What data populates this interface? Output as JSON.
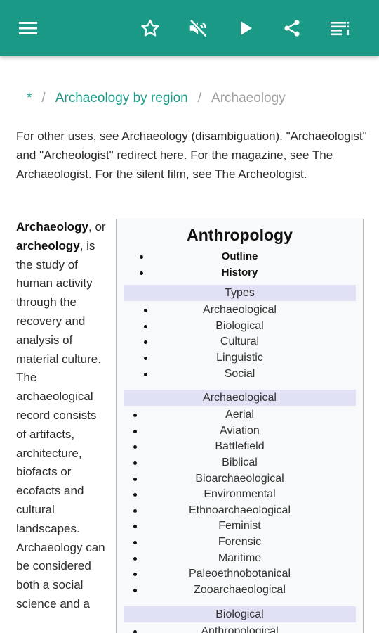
{
  "toolbar": {
    "menu_icon": "menu-icon",
    "favorite_icon": "star-outline-icon",
    "mute_icon": "volume-off-icon",
    "play_icon": "play-icon",
    "share_icon": "share-icon",
    "toc_icon": "list-icon",
    "accent_color": "#1a9a86"
  },
  "breadcrumb": {
    "home": "*",
    "separator": "/",
    "parent": "Archaeology by region",
    "current": "Archaeology"
  },
  "hatnote": "For other uses, see Archaeology (disambiguation). \"Archaeologist\" and \"Archeologist\" redirect here. For the magazine, see The Archaeologist. For the silent film, see The Archeologist.",
  "lead": {
    "term1": "Archaeology",
    "sep1": ",",
    "or": "or",
    "term2": "archeology",
    "rest": ", is the study of human activity through the recovery and analysis of material culture. The archaeological record consists of artifacts, architecture, biofacts or ecofacts and cultural landscapes. Archaeology can be considered both a social science and a"
  },
  "infobox": {
    "title": "Anthropology",
    "top_items": [
      "Outline",
      "History"
    ],
    "types_heading": "Types",
    "types": [
      "Archaeological",
      "Biological",
      "Cultural",
      "Linguistic",
      "Social"
    ],
    "archaeological_heading": "Archaeological",
    "archaeological": [
      "Aerial",
      "Aviation",
      "Battlefield",
      "Biblical",
      "Bioarchaeological",
      "Environmental",
      "Ethnoarchaeological",
      "Feminist",
      "Forensic",
      "Maritime",
      "Paleoethnobotanical",
      "Zooarchaeological"
    ],
    "biological_heading": "Biological",
    "biological": [
      "Anthropological"
    ]
  }
}
